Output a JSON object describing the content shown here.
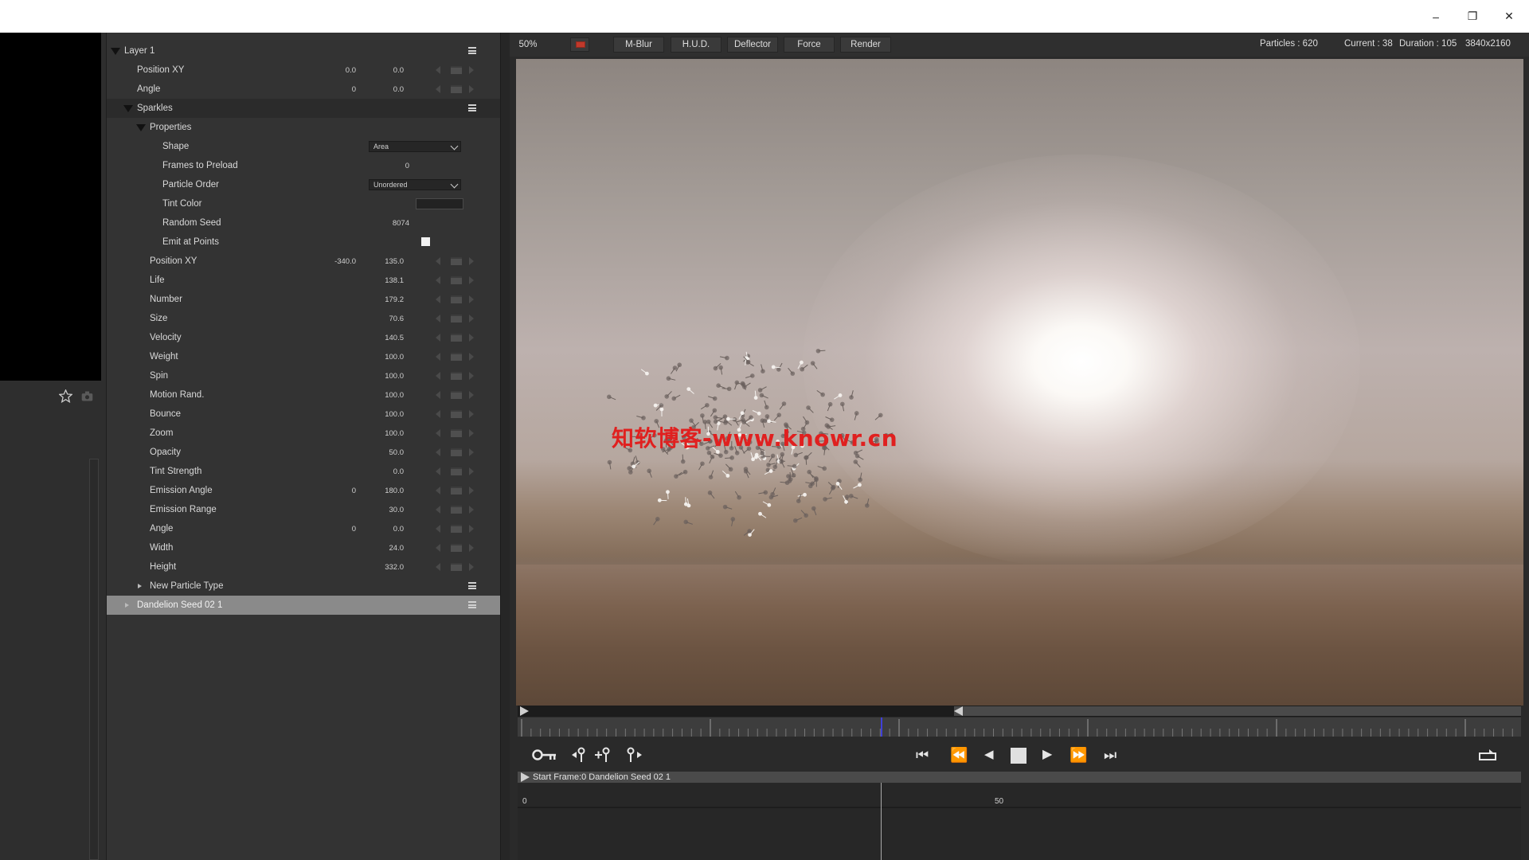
{
  "window": {
    "minimize_glyph": "–",
    "maximize_glyph": "❐",
    "close_glyph": "✕"
  },
  "layer_panel": {
    "rows": [
      {
        "label": "Layer 1",
        "kind": "group"
      },
      {
        "label": "Position XY",
        "v1": "0.0",
        "v2": "0.0",
        "kind": "param"
      },
      {
        "label": "Angle",
        "v1": "0",
        "v2": "0.0",
        "kind": "param"
      },
      {
        "label": "Sparkles",
        "kind": "group"
      },
      {
        "label": "Properties",
        "kind": "subgroup"
      },
      {
        "label": "Shape",
        "dropdown": "Area",
        "kind": "dropdown"
      },
      {
        "label": "Frames to Preload",
        "v2": "0",
        "kind": "value"
      },
      {
        "label": "Particle Order",
        "dropdown": "Unordered",
        "kind": "dropdown"
      },
      {
        "label": "Tint Color",
        "kind": "color"
      },
      {
        "label": "Random Seed",
        "v2": "8074",
        "kind": "value"
      },
      {
        "label": "Emit at Points",
        "kind": "checkbox"
      },
      {
        "label": "Position XY",
        "v1": "-340.0",
        "v2": "135.0",
        "kind": "param"
      },
      {
        "label": "Life",
        "v2": "138.1",
        "kind": "param"
      },
      {
        "label": "Number",
        "v2": "179.2",
        "kind": "param"
      },
      {
        "label": "Size",
        "v2": "70.6",
        "kind": "param"
      },
      {
        "label": "Velocity",
        "v2": "140.5",
        "kind": "param"
      },
      {
        "label": "Weight",
        "v2": "100.0",
        "kind": "param"
      },
      {
        "label": "Spin",
        "v2": "100.0",
        "kind": "param"
      },
      {
        "label": "Motion Rand.",
        "v2": "100.0",
        "kind": "param"
      },
      {
        "label": "Bounce",
        "v2": "100.0",
        "kind": "param"
      },
      {
        "label": "Zoom",
        "v2": "100.0",
        "kind": "param"
      },
      {
        "label": "Opacity",
        "v2": "50.0",
        "kind": "param"
      },
      {
        "label": "Tint Strength",
        "v2": "0.0",
        "kind": "param"
      },
      {
        "label": "Emission Angle",
        "v1": "0",
        "v2": "180.0",
        "kind": "param"
      },
      {
        "label": "Emission Range",
        "v2": "30.0",
        "kind": "param"
      },
      {
        "label": "Angle",
        "v1": "0",
        "v2": "0.0",
        "kind": "param"
      },
      {
        "label": "Width",
        "v2": "24.0",
        "kind": "param"
      },
      {
        "label": "Height",
        "v2": "332.0",
        "kind": "param"
      },
      {
        "label": "New Particle Type",
        "kind": "collapsed"
      },
      {
        "label": "Dandelion Seed 02 1",
        "kind": "selected"
      }
    ]
  },
  "toolbar": {
    "zoom": "50%",
    "mblur": "M-Blur",
    "hud": "H.U.D.",
    "deflector": "Deflector",
    "force": "Force",
    "render": "Render",
    "particles": "Particles : 620",
    "current": "Current : 38",
    "duration": "Duration : 105",
    "resolution": "3840x2160",
    "record_color": "#c0392b"
  },
  "viewer": {
    "watermark": "知软博客-www.knowr.cn"
  },
  "timeline": {
    "track_label": "Start Frame:0 Dandelion Seed 02 1",
    "tick_0": "0",
    "tick_50": "50"
  },
  "transport": {
    "key_icon": "key-icon",
    "go_start": "⏮",
    "rewind": "⏪",
    "step_back": "◀",
    "play": "▶",
    "fast_forward": "⏩",
    "go_end": "⏭",
    "loop_icon": "loop-icon"
  }
}
